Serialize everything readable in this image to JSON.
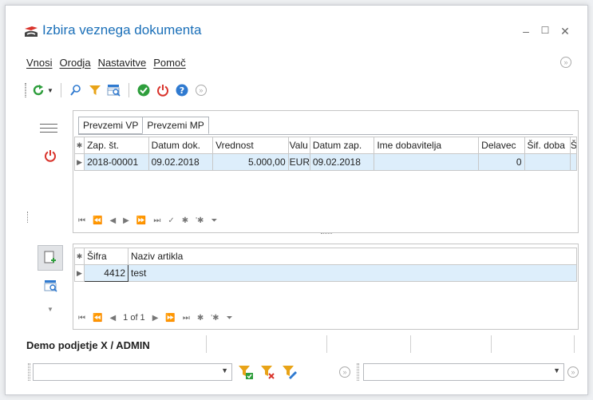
{
  "window": {
    "title": "Izbira veznega dokumenta",
    "minimize": "–",
    "maximize": "☐",
    "close": "✕"
  },
  "menu": {
    "items": [
      "Vnosi",
      "Orodja",
      "Nastavitve",
      "Pomoč"
    ]
  },
  "toolbar": {
    "icons": [
      "refresh-icon",
      "search-icon",
      "filter-icon",
      "grid-search-icon",
      "confirm-icon",
      "power-icon",
      "help-icon",
      "collapse-icon"
    ],
    "colors": {
      "green": "#2e9e3c",
      "red": "#d9332b",
      "blue": "#2f7ad0",
      "orange": "#e8a317"
    }
  },
  "tabs": [
    "Prevzemi VP",
    "Prevzemi MP"
  ],
  "top_grid": {
    "columns": [
      "Zap. št.",
      "Datum dok.",
      "Vrednost",
      "Valu",
      "Datum zap.",
      "Ime dobavitelja",
      "Delavec",
      "Šif. doba",
      "Š"
    ],
    "rows": [
      [
        "2018-00001",
        "09.02.2018",
        "5.000,00",
        "EUR",
        "09.02.2018",
        "",
        "0",
        "",
        ""
      ]
    ]
  },
  "bottom_grid": {
    "columns": [
      "Šifra",
      "Naziv artikla"
    ],
    "rows": [
      [
        "4412",
        "test"
      ]
    ],
    "pager": "1 of 1"
  },
  "status": {
    "company": "Demo podjetje X / ADMIN"
  },
  "filter": {
    "combo1_value": "",
    "combo2_value": ""
  }
}
